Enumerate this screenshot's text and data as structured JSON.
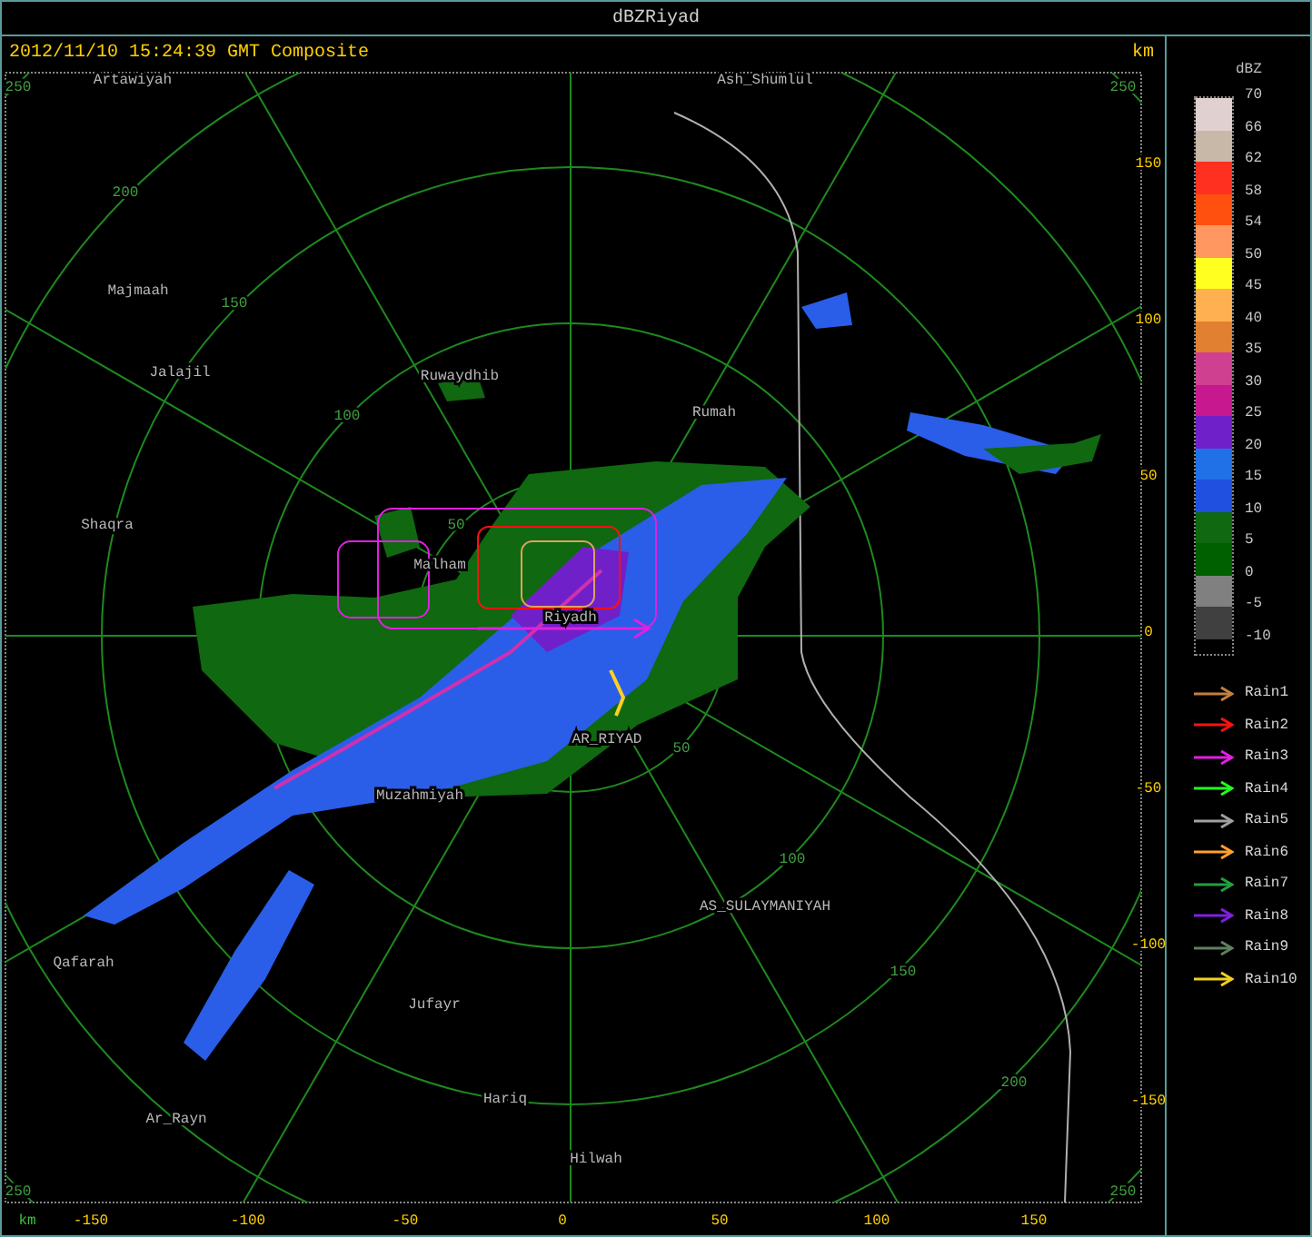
{
  "window": {
    "title": "dBZRiyad"
  },
  "header": {
    "timestamp": "2012/11/10 15:24:39 GMT Composite",
    "unit": "km"
  },
  "map": {
    "corner_labels": [
      "250",
      "250",
      "250",
      "250"
    ],
    "ring_labels": [
      "200",
      "150",
      "100",
      "50",
      "50",
      "100",
      "150",
      "200"
    ],
    "places": [
      "Artawiyah",
      "Ash_Shumlul",
      "Majmaah",
      "Jalajil",
      "Ruwaydhib",
      "Rumah",
      "Shaqra",
      "Malham",
      "Riyadh",
      "AR_RIYAD",
      "Muzahmiyah",
      "AS_SULAYMANIYAH",
      "Qafarah",
      "Jufayr",
      "Hariq",
      "Ar_Rayn",
      "Hilwah"
    ]
  },
  "y_axis": {
    "labels": [
      "150",
      "100",
      "50",
      "0",
      "-50",
      "-100",
      "-150"
    ]
  },
  "x_axis": {
    "unit": "km",
    "labels": [
      "-150",
      "-100",
      "-50",
      "0",
      "50",
      "100",
      "150"
    ]
  },
  "legend": {
    "title": "dBZ",
    "labels": [
      "70",
      "66",
      "62",
      "58",
      "54",
      "50",
      "45",
      "40",
      "35",
      "30",
      "25",
      "20",
      "15",
      "10",
      "5",
      "0",
      "-5",
      "-10"
    ],
    "bands": [
      {
        "color": "#e0d0d0"
      },
      {
        "color": "#c8b8a8"
      },
      {
        "color": "#ff3020"
      },
      {
        "color": "#ff5010"
      },
      {
        "color": "#ff9860"
      },
      {
        "color": "#ffff20"
      },
      {
        "color": "#ffb050"
      },
      {
        "color": "#e08030"
      },
      {
        "color": "#d04090"
      },
      {
        "color": "#c81890"
      },
      {
        "color": "#7020c8"
      },
      {
        "color": "#2070e8"
      },
      {
        "color": "#2050e0"
      },
      {
        "color": "#106810"
      },
      {
        "color": "#006000"
      },
      {
        "color": "#808080"
      },
      {
        "color": "#404040"
      }
    ],
    "tracks": [
      {
        "label": "Rain1",
        "color": "#c08040"
      },
      {
        "label": "Rain2",
        "color": "#ff1010"
      },
      {
        "label": "Rain3",
        "color": "#e020e0"
      },
      {
        "label": "Rain4",
        "color": "#20ff20"
      },
      {
        "label": "Rain5",
        "color": "#a0a0a0"
      },
      {
        "label": "Rain6",
        "color": "#ffa030"
      },
      {
        "label": "Rain7",
        "color": "#20a040"
      },
      {
        "label": "Rain8",
        "color": "#8020e0"
      },
      {
        "label": "Rain9",
        "color": "#608060"
      },
      {
        "label": "Rain10",
        "color": "#f0d020"
      }
    ]
  }
}
